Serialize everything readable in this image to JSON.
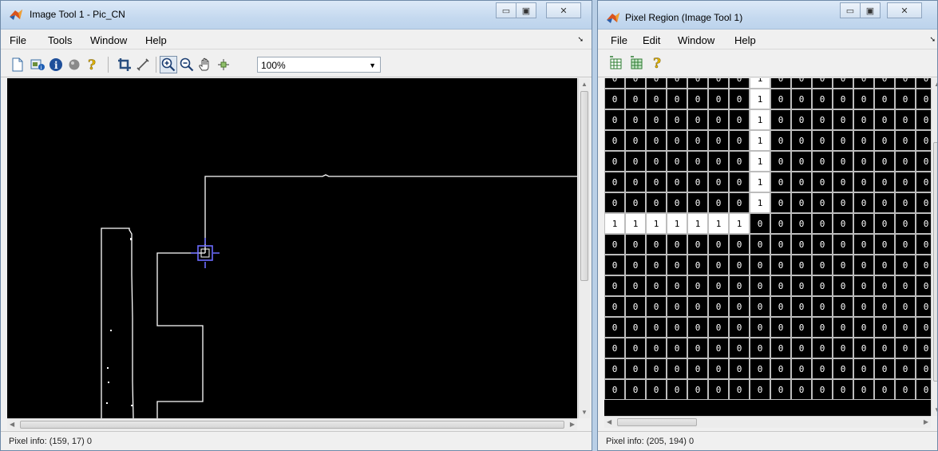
{
  "window1": {
    "title": "Image Tool 1 - Pic_CN",
    "menu": [
      "File",
      "Tools",
      "Window",
      "Help"
    ],
    "toolbar": {
      "icons": [
        "new-figure-icon",
        "image-info-icon",
        "info-icon",
        "circle-icon",
        "help-icon",
        "crop-icon",
        "measure-distance-icon",
        "zoom-in-icon",
        "zoom-out-icon",
        "pan-hand-icon",
        "pixel-region-icon"
      ],
      "zoom_value": "100%"
    },
    "status": "Pixel info: (159, 17)  0"
  },
  "window2": {
    "title": "Pixel Region (Image Tool 1)",
    "menu": [
      "File",
      "Edit",
      "Window",
      "Help"
    ],
    "toolbar_icons": [
      "new-pixel-region-icon",
      "grid-icon",
      "help-icon"
    ],
    "grid_rows": [
      [
        "0",
        "0",
        "0",
        "0",
        "0",
        "0",
        "0",
        "1",
        "0",
        "0",
        "0",
        "0",
        "0",
        "0",
        "0",
        "0"
      ],
      [
        "0",
        "0",
        "0",
        "0",
        "0",
        "0",
        "0",
        "1",
        "0",
        "0",
        "0",
        "0",
        "0",
        "0",
        "0",
        "0"
      ],
      [
        "0",
        "0",
        "0",
        "0",
        "0",
        "0",
        "0",
        "1",
        "0",
        "0",
        "0",
        "0",
        "0",
        "0",
        "0",
        "0"
      ],
      [
        "0",
        "0",
        "0",
        "0",
        "0",
        "0",
        "0",
        "1",
        "0",
        "0",
        "0",
        "0",
        "0",
        "0",
        "0",
        "0"
      ],
      [
        "0",
        "0",
        "0",
        "0",
        "0",
        "0",
        "0",
        "1",
        "0",
        "0",
        "0",
        "0",
        "0",
        "0",
        "0",
        "0"
      ],
      [
        "0",
        "0",
        "0",
        "0",
        "0",
        "0",
        "0",
        "1",
        "0",
        "0",
        "0",
        "0",
        "0",
        "0",
        "0",
        "0"
      ],
      [
        "0",
        "0",
        "0",
        "0",
        "0",
        "0",
        "0",
        "1",
        "0",
        "0",
        "0",
        "0",
        "0",
        "0",
        "0",
        "0"
      ],
      [
        "1",
        "1",
        "1",
        "1",
        "1",
        "1",
        "1",
        "0",
        "0",
        "0",
        "0",
        "0",
        "0",
        "0",
        "0",
        "0"
      ],
      [
        "0",
        "0",
        "0",
        "0",
        "0",
        "0",
        "0",
        "0",
        "0",
        "0",
        "0",
        "0",
        "0",
        "0",
        "0",
        "0"
      ],
      [
        "0",
        "0",
        "0",
        "0",
        "0",
        "0",
        "0",
        "0",
        "0",
        "0",
        "0",
        "0",
        "0",
        "0",
        "0",
        "0"
      ],
      [
        "0",
        "0",
        "0",
        "0",
        "0",
        "0",
        "0",
        "0",
        "0",
        "0",
        "0",
        "0",
        "0",
        "0",
        "0",
        "0"
      ],
      [
        "0",
        "0",
        "0",
        "0",
        "0",
        "0",
        "0",
        "0",
        "0",
        "0",
        "0",
        "0",
        "0",
        "0",
        "0",
        "0"
      ],
      [
        "0",
        "0",
        "0",
        "0",
        "0",
        "0",
        "0",
        "0",
        "0",
        "0",
        "0",
        "0",
        "0",
        "0",
        "0",
        "0"
      ],
      [
        "0",
        "0",
        "0",
        "0",
        "0",
        "0",
        "0",
        "0",
        "0",
        "0",
        "0",
        "0",
        "0",
        "0",
        "0",
        "0"
      ],
      [
        "0",
        "0",
        "0",
        "0",
        "0",
        "0",
        "0",
        "0",
        "0",
        "0",
        "0",
        "0",
        "0",
        "0",
        "0",
        "0"
      ],
      [
        "0",
        "0",
        "0",
        "0",
        "0",
        "0",
        "0",
        "0",
        "0",
        "0",
        "0",
        "0",
        "0",
        "0",
        "0",
        "0"
      ]
    ],
    "status": "Pixel info: (205, 194)  0"
  },
  "colors": {
    "titlebar": "#c5d9ef",
    "canvas_bg": "#000000",
    "pixel_off": "#000000",
    "pixel_on": "#ffffff",
    "rect_marker": "#6c6cff"
  }
}
